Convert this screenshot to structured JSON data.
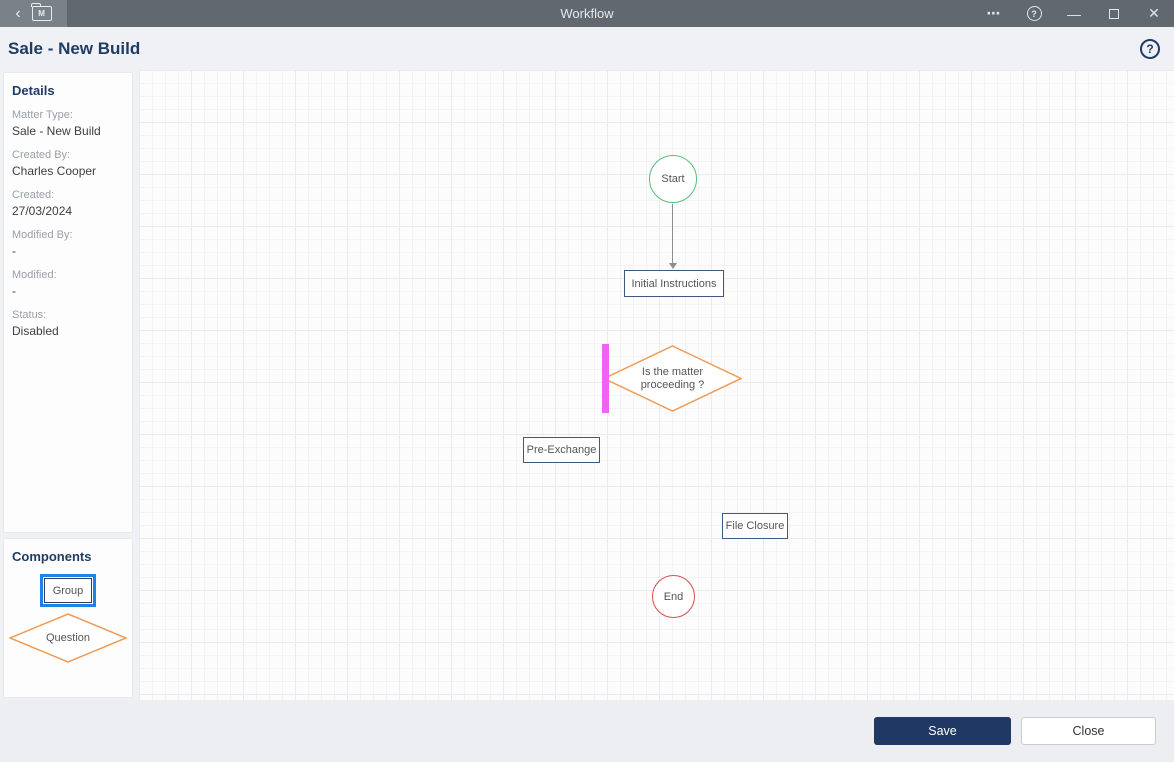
{
  "window": {
    "title": "Workflow",
    "icons": {
      "back": "‹",
      "folder_letter": "M",
      "ellipsis": "⋯",
      "help": "?",
      "minimize": "—",
      "close": "✕"
    }
  },
  "header": {
    "title": "Sale - New Build",
    "help": "?"
  },
  "sidebar": {
    "details": {
      "heading": "Details",
      "fields": [
        {
          "label": "Matter Type:",
          "value": "Sale - New Build"
        },
        {
          "label": "Created By:",
          "value": "Charles Cooper"
        },
        {
          "label": "Created:",
          "value": "27/03/2024"
        },
        {
          "label": "Modified By:",
          "value": "-"
        },
        {
          "label": "Modified:",
          "value": "-"
        },
        {
          "label": "Status:",
          "value": "Disabled"
        }
      ]
    },
    "components": {
      "heading": "Components",
      "items": [
        {
          "label": "Group",
          "shape": "rectangle",
          "selected": true
        },
        {
          "label": "Question",
          "shape": "diamond",
          "selected": false
        }
      ]
    }
  },
  "canvas": {
    "nodes": {
      "start": {
        "label": "Start",
        "type": "circle",
        "color": "#55c07b"
      },
      "initial_instructions": {
        "label": "Initial Instructions",
        "type": "box"
      },
      "question": {
        "label": "Is the matter proceeding ?",
        "type": "diamond",
        "color": "#f09b55"
      },
      "pre_exchange": {
        "label": "Pre-Exchange",
        "type": "box"
      },
      "file_closure": {
        "label": "File Closure",
        "type": "box"
      },
      "end": {
        "label": "End",
        "type": "circle",
        "color": "#d14f4f"
      }
    }
  },
  "footer": {
    "save_label": "Save",
    "close_label": "Close"
  },
  "colors": {
    "titlebar": "#62686f",
    "titlebar_left": "#7b8189",
    "accent_navy": "#1f3864",
    "heading_navy": "#1f3c66",
    "node_border_navy": "#3d5a80",
    "start_green": "#55c07b",
    "end_red": "#d14f4f",
    "question_orange": "#f09b55",
    "selection_pink": "#ee64ee",
    "selection_blue": "#1e82e8",
    "canvas_bg": "#fcfcfd"
  }
}
